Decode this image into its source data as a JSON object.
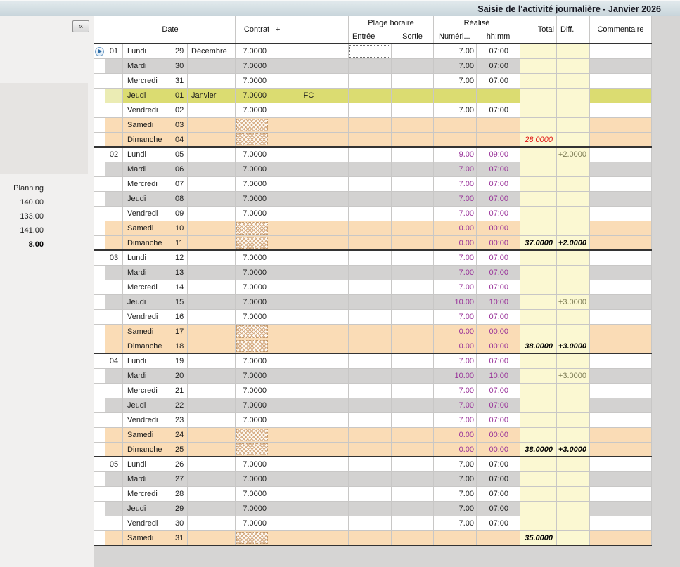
{
  "title": "Saisie de l'activité journalière - Janvier 2026",
  "icons": {
    "collapse": "«",
    "current_row": "play-circle"
  },
  "sidebar": {
    "planning_label": "Planning",
    "planning_values": [
      "140.00",
      "133.00",
      "141.00",
      "8.00"
    ]
  },
  "header": {
    "date": "Date",
    "contrat": "Contrat",
    "plus": "+",
    "plage_horaire": "Plage horaire",
    "entree": "Entrée",
    "sortie": "Sortie",
    "realise": "Réalisé",
    "numeri": "Numéri...",
    "hhmm": "hh:mm",
    "total": "Total",
    "diff": "Diff.",
    "commentaire": "Commentaire"
  },
  "colors": {
    "titlebar_top": "#e1e9ec",
    "titlebar_bottom": "#c8d5db",
    "title_text": "#14141e",
    "sidebar_bg": "#f1f0ef",
    "sidebar_panel": "#e6e4e2",
    "main_bg": "#d6d5d4",
    "grid_line": "#c8c7c6",
    "dark_line": "#333333",
    "row_gray": "#d3d2d1",
    "row_weekend": "#fadcb6",
    "row_holiday": "#dbdc71",
    "holiday_week_cell": "#ebecb4",
    "yellow_col": "#fbf8d2",
    "text_black": "#1c1c1c",
    "text_purple": "#993299",
    "text_olive": "#7d7c55",
    "text_red": "#e01111",
    "hatch_line": "#d4a97f",
    "hatch_bg": "#fdf8f1"
  },
  "rows": [
    {
      "week": "01",
      "day": "Lundi",
      "num": "29",
      "month": "Décembre",
      "contrat": "7.0000",
      "rnum": "7.00",
      "rhh": "07:00",
      "type": "white",
      "vcolor": "black",
      "ind": true,
      "focus": true
    },
    {
      "day": "Mardi",
      "num": "30",
      "contrat": "7.0000",
      "rnum": "7.00",
      "rhh": "07:00",
      "type": "gray",
      "vcolor": "black"
    },
    {
      "day": "Mercredi",
      "num": "31",
      "contrat": "7.0000",
      "rnum": "7.00",
      "rhh": "07:00",
      "type": "white",
      "vcolor": "black"
    },
    {
      "day": "Jeudi",
      "num": "01",
      "month": "Janvier",
      "contrat": "7.0000",
      "plus": "FC",
      "type": "holiday"
    },
    {
      "day": "Vendredi",
      "num": "02",
      "contrat": "7.0000",
      "rnum": "7.00",
      "rhh": "07:00",
      "type": "white",
      "vcolor": "black"
    },
    {
      "day": "Samedi",
      "num": "03",
      "type": "weekend",
      "hatch": true
    },
    {
      "day": "Dimanche",
      "num": "04",
      "type": "weekend",
      "hatch": true,
      "total": "28.0000",
      "tstyle": "red",
      "sep": true
    },
    {
      "week": "02",
      "day": "Lundi",
      "num": "05",
      "contrat": "7.0000",
      "rnum": "9.00",
      "rhh": "09:00",
      "diff": "+2.0000",
      "dstyle": "olive",
      "type": "white",
      "vcolor": "purple"
    },
    {
      "day": "Mardi",
      "num": "06",
      "contrat": "7.0000",
      "rnum": "7.00",
      "rhh": "07:00",
      "type": "gray",
      "vcolor": "purple"
    },
    {
      "day": "Mercredi",
      "num": "07",
      "contrat": "7.0000",
      "rnum": "7.00",
      "rhh": "07:00",
      "type": "white",
      "vcolor": "purple"
    },
    {
      "day": "Jeudi",
      "num": "08",
      "contrat": "7.0000",
      "rnum": "7.00",
      "rhh": "07:00",
      "type": "gray",
      "vcolor": "purple"
    },
    {
      "day": "Vendredi",
      "num": "09",
      "contrat": "7.0000",
      "rnum": "7.00",
      "rhh": "07:00",
      "type": "white",
      "vcolor": "purple"
    },
    {
      "day": "Samedi",
      "num": "10",
      "type": "weekend",
      "hatch": true,
      "rnum": "0.00",
      "rhh": "00:00",
      "vcolor": "purple"
    },
    {
      "day": "Dimanche",
      "num": "11",
      "type": "weekend",
      "hatch": true,
      "rnum": "0.00",
      "rhh": "00:00",
      "vcolor": "purple",
      "total": "37.0000",
      "tstyle": "sum",
      "diff": "+2.0000",
      "dstyle": "sum",
      "sep": true
    },
    {
      "week": "03",
      "day": "Lundi",
      "num": "12",
      "contrat": "7.0000",
      "rnum": "7.00",
      "rhh": "07:00",
      "type": "white",
      "vcolor": "purple"
    },
    {
      "day": "Mardi",
      "num": "13",
      "contrat": "7.0000",
      "rnum": "7.00",
      "rhh": "07:00",
      "type": "gray",
      "vcolor": "purple"
    },
    {
      "day": "Mercredi",
      "num": "14",
      "contrat": "7.0000",
      "rnum": "7.00",
      "rhh": "07:00",
      "type": "white",
      "vcolor": "purple"
    },
    {
      "day": "Jeudi",
      "num": "15",
      "contrat": "7.0000",
      "rnum": "10.00",
      "rhh": "10:00",
      "diff": "+3.0000",
      "dstyle": "olive",
      "type": "gray",
      "vcolor": "purple"
    },
    {
      "day": "Vendredi",
      "num": "16",
      "contrat": "7.0000",
      "rnum": "7.00",
      "rhh": "07:00",
      "type": "white",
      "vcolor": "purple"
    },
    {
      "day": "Samedi",
      "num": "17",
      "type": "weekend",
      "hatch": true,
      "rnum": "0.00",
      "rhh": "00:00",
      "vcolor": "purple"
    },
    {
      "day": "Dimanche",
      "num": "18",
      "type": "weekend",
      "hatch": true,
      "rnum": "0.00",
      "rhh": "00:00",
      "vcolor": "purple",
      "total": "38.0000",
      "tstyle": "sum",
      "diff": "+3.0000",
      "dstyle": "sum",
      "sep": true
    },
    {
      "week": "04",
      "day": "Lundi",
      "num": "19",
      "contrat": "7.0000",
      "rnum": "7.00",
      "rhh": "07:00",
      "type": "white",
      "vcolor": "purple"
    },
    {
      "day": "Mardi",
      "num": "20",
      "contrat": "7.0000",
      "rnum": "10.00",
      "rhh": "10:00",
      "diff": "+3.0000",
      "dstyle": "olive",
      "type": "gray",
      "vcolor": "purple"
    },
    {
      "day": "Mercredi",
      "num": "21",
      "contrat": "7.0000",
      "rnum": "7.00",
      "rhh": "07:00",
      "type": "white",
      "vcolor": "purple"
    },
    {
      "day": "Jeudi",
      "num": "22",
      "contrat": "7.0000",
      "rnum": "7.00",
      "rhh": "07:00",
      "type": "gray",
      "vcolor": "purple"
    },
    {
      "day": "Vendredi",
      "num": "23",
      "contrat": "7.0000",
      "rnum": "7.00",
      "rhh": "07:00",
      "type": "white",
      "vcolor": "purple"
    },
    {
      "day": "Samedi",
      "num": "24",
      "type": "weekend",
      "hatch": true,
      "rnum": "0.00",
      "rhh": "00:00",
      "vcolor": "purple"
    },
    {
      "day": "Dimanche",
      "num": "25",
      "type": "weekend",
      "hatch": true,
      "rnum": "0.00",
      "rhh": "00:00",
      "vcolor": "purple",
      "total": "38.0000",
      "tstyle": "sum",
      "diff": "+3.0000",
      "dstyle": "sum",
      "sep": true
    },
    {
      "week": "05",
      "day": "Lundi",
      "num": "26",
      "contrat": "7.0000",
      "rnum": "7.00",
      "rhh": "07:00",
      "type": "white",
      "vcolor": "black"
    },
    {
      "day": "Mardi",
      "num": "27",
      "contrat": "7.0000",
      "rnum": "7.00",
      "rhh": "07:00",
      "type": "gray",
      "vcolor": "black"
    },
    {
      "day": "Mercredi",
      "num": "28",
      "contrat": "7.0000",
      "rnum": "7.00",
      "rhh": "07:00",
      "type": "white",
      "vcolor": "black"
    },
    {
      "day": "Jeudi",
      "num": "29",
      "contrat": "7.0000",
      "rnum": "7.00",
      "rhh": "07:00",
      "type": "gray",
      "vcolor": "black"
    },
    {
      "day": "Vendredi",
      "num": "30",
      "contrat": "7.0000",
      "rnum": "7.00",
      "rhh": "07:00",
      "type": "white",
      "vcolor": "black"
    },
    {
      "day": "Samedi",
      "num": "31",
      "type": "weekend",
      "hatch": true,
      "total": "35.0000",
      "tstyle": "sum",
      "sep": true
    }
  ]
}
